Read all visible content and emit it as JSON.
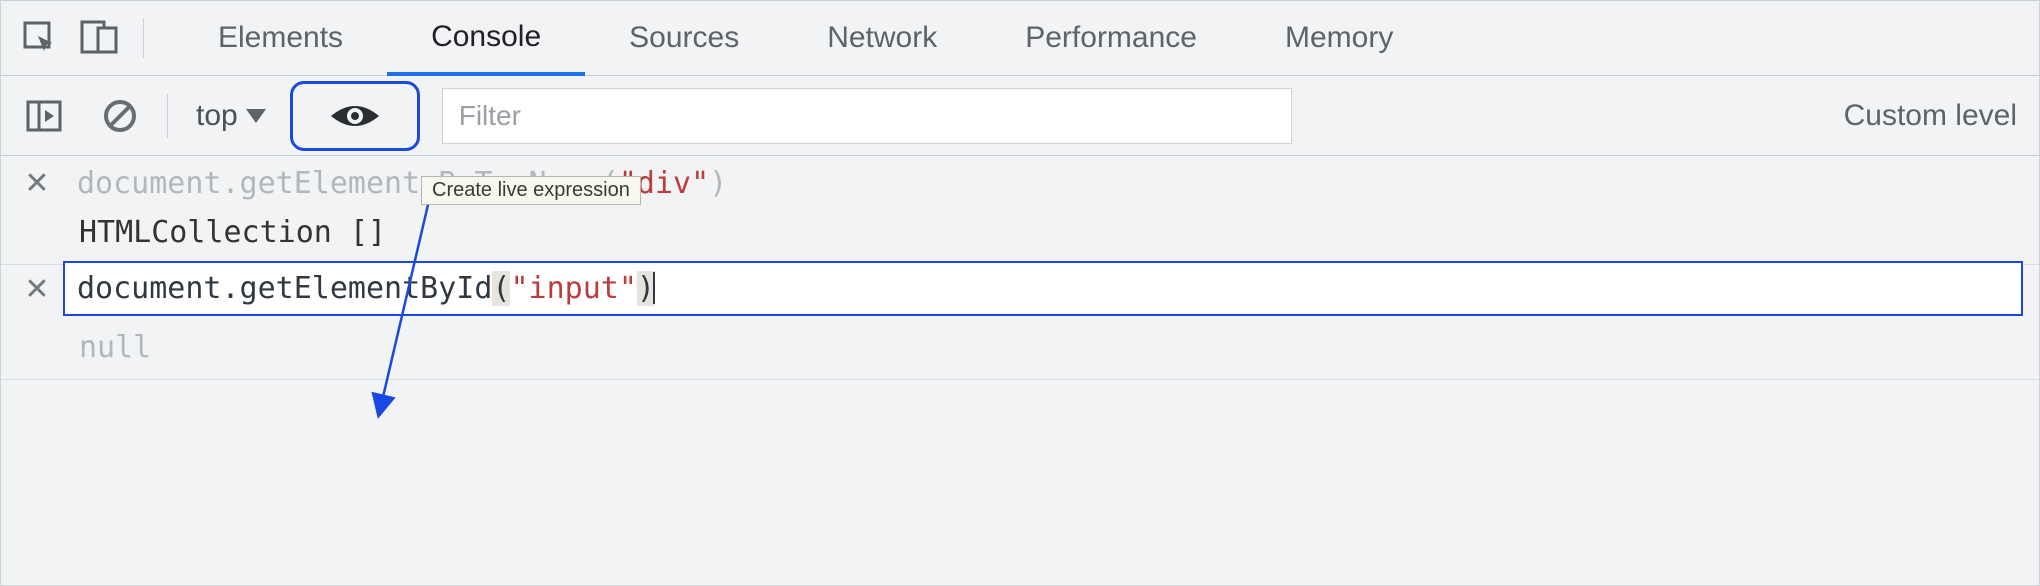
{
  "tabs": {
    "elements": "Elements",
    "console": "Console",
    "sources": "Sources",
    "network": "Network",
    "performance": "Performance",
    "memory": "Memory"
  },
  "toolbar": {
    "context_label": "top",
    "filter_placeholder": "Filter",
    "levels_label": "Custom level",
    "eye_tooltip": "Create live expression"
  },
  "expressions": [
    {
      "code_prefix": "document.getElementsByTagName(",
      "code_arg": "\"div\"",
      "code_suffix": ")",
      "result": "HTMLCollection []"
    },
    {
      "code_prefix": "document.getElementById",
      "open_paren": "(",
      "code_arg": "\"input\"",
      "close_paren": ")",
      "result": "null"
    }
  ]
}
